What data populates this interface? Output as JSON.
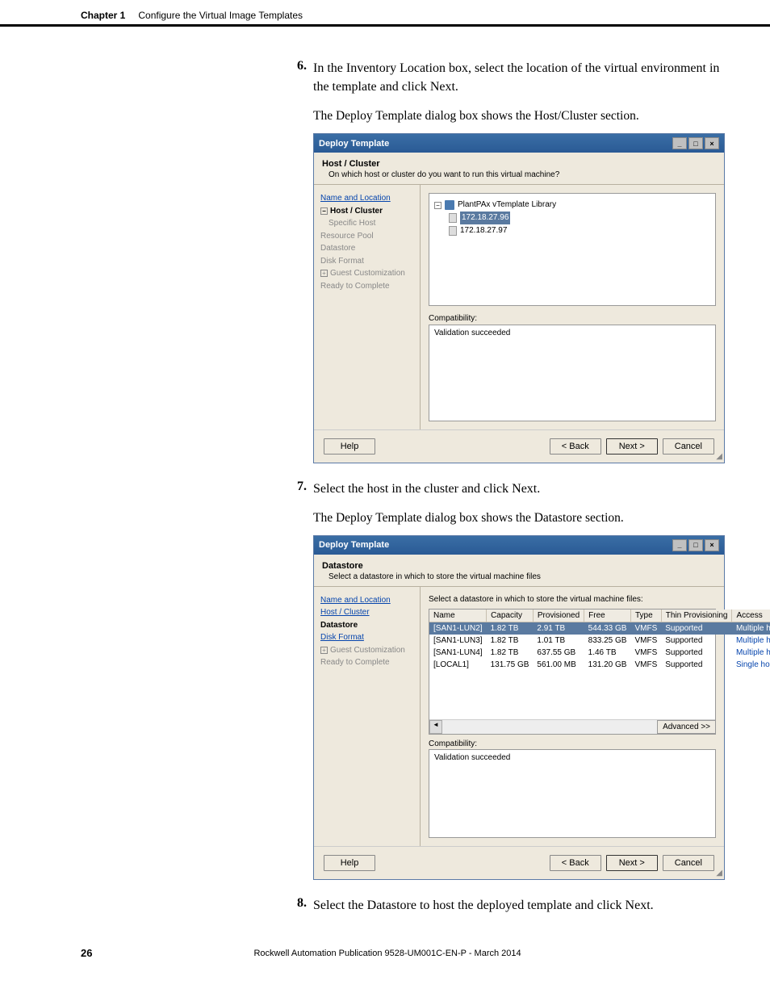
{
  "header": {
    "chapter": "Chapter 1",
    "title": "Configure the Virtual Image Templates"
  },
  "steps": {
    "s6": {
      "num": "6.",
      "text": "In the Inventory Location box, select the location of the virtual environment in the template and click Next."
    },
    "s6b": "The Deploy Template dialog box shows the Host/Cluster section.",
    "s7": {
      "num": "7.",
      "text": "Select the host in the cluster and click Next."
    },
    "s7b": "The Deploy Template dialog box shows the Datastore section.",
    "s8": {
      "num": "8.",
      "text": "Select the Datastore to host the deployed template and click Next."
    }
  },
  "dialog1": {
    "title": "Deploy Template",
    "hdr_title": "Host / Cluster",
    "hdr_sub": "On which host or cluster do you want to run this virtual machine?",
    "sidebar": {
      "name_loc": "Name and Location",
      "host_cluster": "Host / Cluster",
      "specific_host": "Specific Host",
      "resource_pool": "Resource Pool",
      "datastore": "Datastore",
      "disk_format": "Disk Format",
      "guest_cust": "Guest Customization",
      "ready": "Ready to Complete"
    },
    "tree": {
      "root": "PlantPAx vTemplate Library",
      "host1": "172.18.27.96",
      "host2": "172.18.27.97"
    },
    "compat_label": "Compatibility:",
    "compat_text": "Validation succeeded",
    "buttons": {
      "help": "Help",
      "back": "< Back",
      "next": "Next >",
      "cancel": "Cancel"
    }
  },
  "dialog2": {
    "title": "Deploy Template",
    "hdr_title": "Datastore",
    "hdr_sub": "Select a datastore in which to store the virtual machine files",
    "sidebar": {
      "name_loc": "Name and Location",
      "host_cluster": "Host / Cluster",
      "datastore": "Datastore",
      "disk_format": "Disk Format",
      "guest_cust": "Guest Customization",
      "ready": "Ready to Complete"
    },
    "instr": "Select a datastore in which to store the virtual machine files:",
    "cols": {
      "name": "Name",
      "cap": "Capacity",
      "prov": "Provisioned",
      "free": "Free",
      "type": "Type",
      "thin": "Thin Provisioning",
      "access": "Access"
    },
    "rows": [
      {
        "name": "[SAN1-LUN2]",
        "cap": "1.82 TB",
        "prov": "2.91 TB",
        "free": "544.33 GB",
        "type": "VMFS",
        "thin": "Supported",
        "access": "Multiple ho"
      },
      {
        "name": "[SAN1-LUN3]",
        "cap": "1.82 TB",
        "prov": "1.01 TB",
        "free": "833.25 GB",
        "type": "VMFS",
        "thin": "Supported",
        "access": "Multiple ho"
      },
      {
        "name": "[SAN1-LUN4]",
        "cap": "1.82 TB",
        "prov": "637.55 GB",
        "free": "1.46 TB",
        "type": "VMFS",
        "thin": "Supported",
        "access": "Multiple ho"
      },
      {
        "name": "[LOCAL1]",
        "cap": "131.75 GB",
        "prov": "561.00 MB",
        "free": "131.20 GB",
        "type": "VMFS",
        "thin": "Supported",
        "access": "Single hos"
      }
    ],
    "compat_label": "Compatibility:",
    "adv_btn": "Advanced >>",
    "compat_text": "Validation succeeded",
    "buttons": {
      "help": "Help",
      "back": "< Back",
      "next": "Next >",
      "cancel": "Cancel"
    }
  },
  "footer": {
    "page": "26",
    "pub": "Rockwell Automation Publication 9528-UM001C-EN-P - March 2014"
  }
}
